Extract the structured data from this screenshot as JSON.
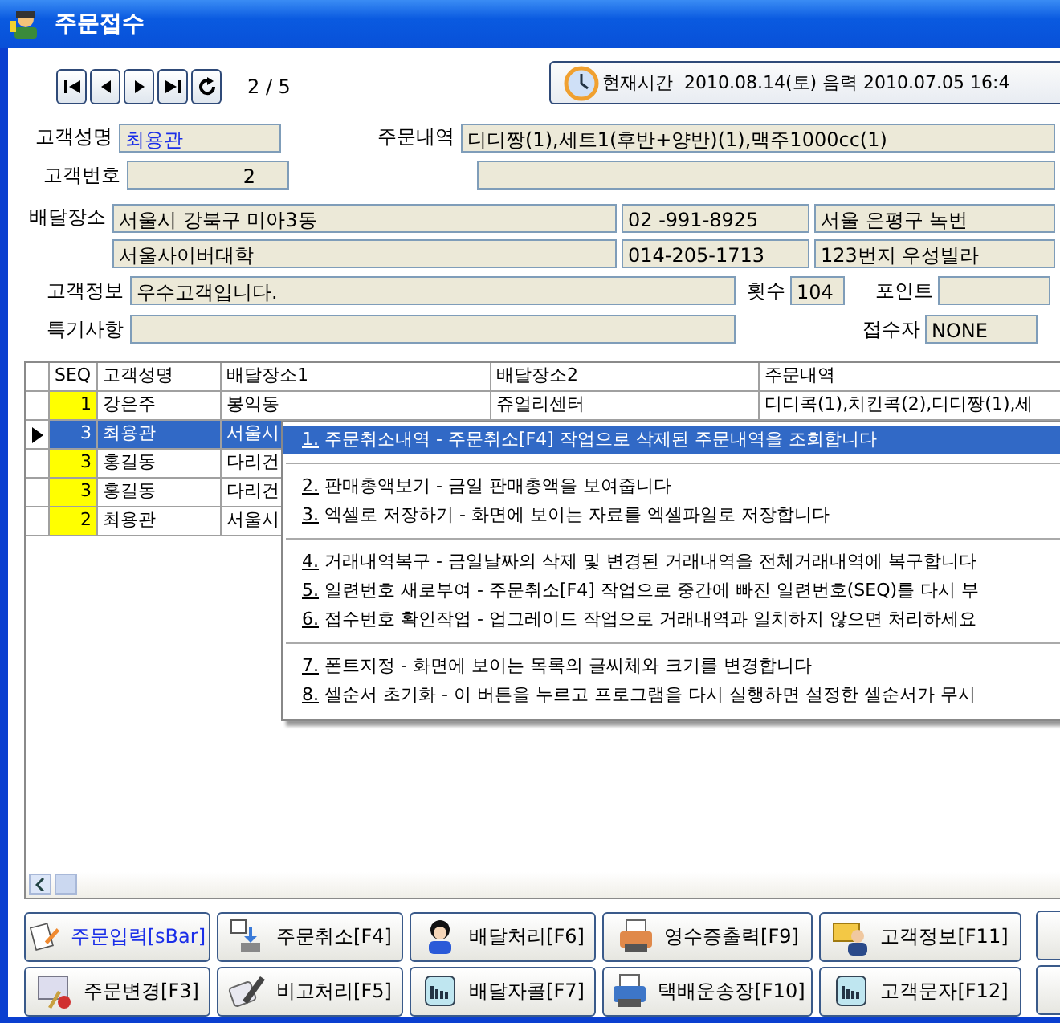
{
  "window": {
    "title": "주문접수"
  },
  "navigator": {
    "position": "2 / 5"
  },
  "clock": {
    "label": "현재시간",
    "value": "2010.08.14(토) 음력 2010.07.05 16:4"
  },
  "form": {
    "labels": {
      "name": "고객성명",
      "order": "주문내역",
      "number": "고객번호",
      "address": "배달장소",
      "info": "고객정보",
      "count": "횟수",
      "points": "포인트",
      "note": "특기사항",
      "receiver": "접수자"
    },
    "customer_name": "최용관",
    "order": "디디짱(1),세트1(후반+양반)(1),맥주1000cc(1)",
    "customer_no": "2",
    "address_lines": [
      {
        "address": "서울시 강북구 미아3동",
        "phone": "02   -991-8925",
        "extra": "서울 은평구 녹번"
      },
      {
        "address": "서울사이버대학",
        "phone": "014-205-1713",
        "extra": "123번지 우성빌라"
      }
    ],
    "info": "우수고객입니다.",
    "count": "104",
    "receiver": "NONE"
  },
  "grid": {
    "columns": [
      "SEQ",
      "고객성명",
      "배달장소1",
      "배달장소2",
      "주문내역"
    ],
    "rows": [
      {
        "selected": false,
        "cells": [
          "1",
          "강은주",
          "봉익동",
          "쥬얼리센터",
          "디디콕(1),치킨콕(2),디디짱(1),세"
        ]
      },
      {
        "selected": true,
        "cells": [
          "3",
          "최용관",
          "서울시",
          "",
          ""
        ]
      },
      {
        "selected": false,
        "cells": [
          "3",
          "홍길동",
          "다리건",
          "",
          ""
        ]
      },
      {
        "selected": false,
        "cells": [
          "3",
          "홍길동",
          "다리건",
          "",
          ""
        ]
      },
      {
        "selected": false,
        "cells": [
          "2",
          "최용관",
          "서울시",
          "",
          ""
        ]
      }
    ]
  },
  "context_menu": {
    "groups": [
      [
        {
          "key": "1.",
          "label": "주문취소내역 - 주문취소[F4] 작업으로 삭제된 주문내역을 조회합니다",
          "selected": true
        }
      ],
      [
        {
          "key": "2.",
          "label": "판매총액보기 - 금일 판매총액을 보여줍니다",
          "selected": false
        },
        {
          "key": "3.",
          "label": "엑셀로 저장하기 - 화면에 보이는 자료를 엑셀파일로 저장합니다",
          "selected": false
        }
      ],
      [
        {
          "key": "4.",
          "label": "거래내역복구 - 금일날짜의 삭제 및 변경된 거래내역을 전체거래내역에 복구합니다",
          "selected": false
        },
        {
          "key": "5.",
          "label": "일련번호 새로부여 -  주문취소[F4] 작업으로 중간에 빠진 일련번호(SEQ)를 다시 부",
          "selected": false
        },
        {
          "key": "6.",
          "label": "접수번호 확인작업 - 업그레이드 작업으로 거래내역과 일치하지 않으면 처리하세요",
          "selected": false
        }
      ],
      [
        {
          "key": "7.",
          "label": "폰트지정 - 화면에 보이는  목록의 글씨체와 크기를 변경합니다",
          "selected": false
        },
        {
          "key": "8.",
          "label": "셀순서 초기화 - 이 버튼을 누르고 프로그램을 다시 실행하면 설정한 셀순서가 무시",
          "selected": false
        }
      ]
    ]
  },
  "buttons": [
    {
      "label": "주문입력[sBar]",
      "active": true
    },
    {
      "label": "주문취소[F4]",
      "active": false
    },
    {
      "label": "배달처리[F6]",
      "active": false
    },
    {
      "label": "영수증출력[F9]",
      "active": false
    },
    {
      "label": "고객정보[F11]",
      "active": false
    },
    {
      "label": "주문변경[F3]",
      "active": false
    },
    {
      "label": "비고처리[F5]",
      "active": false
    },
    {
      "label": "배달자콜[F7]",
      "active": false
    },
    {
      "label": "택배운송장[F10]",
      "active": false
    },
    {
      "label": "고객문자[F12]",
      "active": false
    }
  ]
}
